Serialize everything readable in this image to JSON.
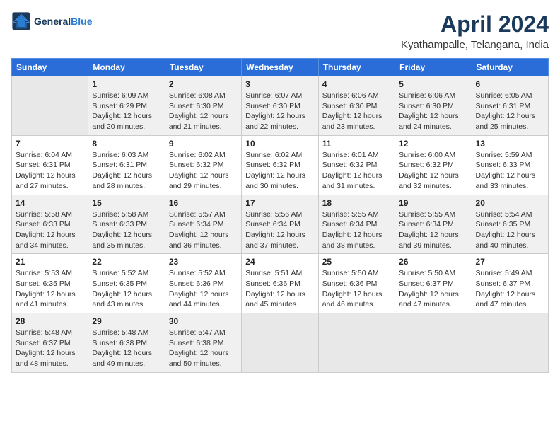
{
  "logo": {
    "line1": "General",
    "line2": "Blue"
  },
  "title": "April 2024",
  "location": "Kyathampalle, Telangana, India",
  "days_of_week": [
    "Sunday",
    "Monday",
    "Tuesday",
    "Wednesday",
    "Thursday",
    "Friday",
    "Saturday"
  ],
  "weeks": [
    [
      {
        "day": "",
        "empty": true
      },
      {
        "day": "1",
        "sunrise": "6:09 AM",
        "sunset": "6:29 PM",
        "daylight": "12 hours and 20 minutes."
      },
      {
        "day": "2",
        "sunrise": "6:08 AM",
        "sunset": "6:30 PM",
        "daylight": "12 hours and 21 minutes."
      },
      {
        "day": "3",
        "sunrise": "6:07 AM",
        "sunset": "6:30 PM",
        "daylight": "12 hours and 22 minutes."
      },
      {
        "day": "4",
        "sunrise": "6:06 AM",
        "sunset": "6:30 PM",
        "daylight": "12 hours and 23 minutes."
      },
      {
        "day": "5",
        "sunrise": "6:06 AM",
        "sunset": "6:30 PM",
        "daylight": "12 hours and 24 minutes."
      },
      {
        "day": "6",
        "sunrise": "6:05 AM",
        "sunset": "6:31 PM",
        "daylight": "12 hours and 25 minutes."
      }
    ],
    [
      {
        "day": "7",
        "sunrise": "6:04 AM",
        "sunset": "6:31 PM",
        "daylight": "12 hours and 27 minutes."
      },
      {
        "day": "8",
        "sunrise": "6:03 AM",
        "sunset": "6:31 PM",
        "daylight": "12 hours and 28 minutes."
      },
      {
        "day": "9",
        "sunrise": "6:02 AM",
        "sunset": "6:32 PM",
        "daylight": "12 hours and 29 minutes."
      },
      {
        "day": "10",
        "sunrise": "6:02 AM",
        "sunset": "6:32 PM",
        "daylight": "12 hours and 30 minutes."
      },
      {
        "day": "11",
        "sunrise": "6:01 AM",
        "sunset": "6:32 PM",
        "daylight": "12 hours and 31 minutes."
      },
      {
        "day": "12",
        "sunrise": "6:00 AM",
        "sunset": "6:32 PM",
        "daylight": "12 hours and 32 minutes."
      },
      {
        "day": "13",
        "sunrise": "5:59 AM",
        "sunset": "6:33 PM",
        "daylight": "12 hours and 33 minutes."
      }
    ],
    [
      {
        "day": "14",
        "sunrise": "5:58 AM",
        "sunset": "6:33 PM",
        "daylight": "12 hours and 34 minutes."
      },
      {
        "day": "15",
        "sunrise": "5:58 AM",
        "sunset": "6:33 PM",
        "daylight": "12 hours and 35 minutes."
      },
      {
        "day": "16",
        "sunrise": "5:57 AM",
        "sunset": "6:34 PM",
        "daylight": "12 hours and 36 minutes."
      },
      {
        "day": "17",
        "sunrise": "5:56 AM",
        "sunset": "6:34 PM",
        "daylight": "12 hours and 37 minutes."
      },
      {
        "day": "18",
        "sunrise": "5:55 AM",
        "sunset": "6:34 PM",
        "daylight": "12 hours and 38 minutes."
      },
      {
        "day": "19",
        "sunrise": "5:55 AM",
        "sunset": "6:34 PM",
        "daylight": "12 hours and 39 minutes."
      },
      {
        "day": "20",
        "sunrise": "5:54 AM",
        "sunset": "6:35 PM",
        "daylight": "12 hours and 40 minutes."
      }
    ],
    [
      {
        "day": "21",
        "sunrise": "5:53 AM",
        "sunset": "6:35 PM",
        "daylight": "12 hours and 41 minutes."
      },
      {
        "day": "22",
        "sunrise": "5:52 AM",
        "sunset": "6:35 PM",
        "daylight": "12 hours and 43 minutes."
      },
      {
        "day": "23",
        "sunrise": "5:52 AM",
        "sunset": "6:36 PM",
        "daylight": "12 hours and 44 minutes."
      },
      {
        "day": "24",
        "sunrise": "5:51 AM",
        "sunset": "6:36 PM",
        "daylight": "12 hours and 45 minutes."
      },
      {
        "day": "25",
        "sunrise": "5:50 AM",
        "sunset": "6:36 PM",
        "daylight": "12 hours and 46 minutes."
      },
      {
        "day": "26",
        "sunrise": "5:50 AM",
        "sunset": "6:37 PM",
        "daylight": "12 hours and 47 minutes."
      },
      {
        "day": "27",
        "sunrise": "5:49 AM",
        "sunset": "6:37 PM",
        "daylight": "12 hours and 47 minutes."
      }
    ],
    [
      {
        "day": "28",
        "sunrise": "5:48 AM",
        "sunset": "6:37 PM",
        "daylight": "12 hours and 48 minutes."
      },
      {
        "day": "29",
        "sunrise": "5:48 AM",
        "sunset": "6:38 PM",
        "daylight": "12 hours and 49 minutes."
      },
      {
        "day": "30",
        "sunrise": "5:47 AM",
        "sunset": "6:38 PM",
        "daylight": "12 hours and 50 minutes."
      },
      {
        "day": "",
        "empty": true
      },
      {
        "day": "",
        "empty": true
      },
      {
        "day": "",
        "empty": true
      },
      {
        "day": "",
        "empty": true
      }
    ]
  ]
}
